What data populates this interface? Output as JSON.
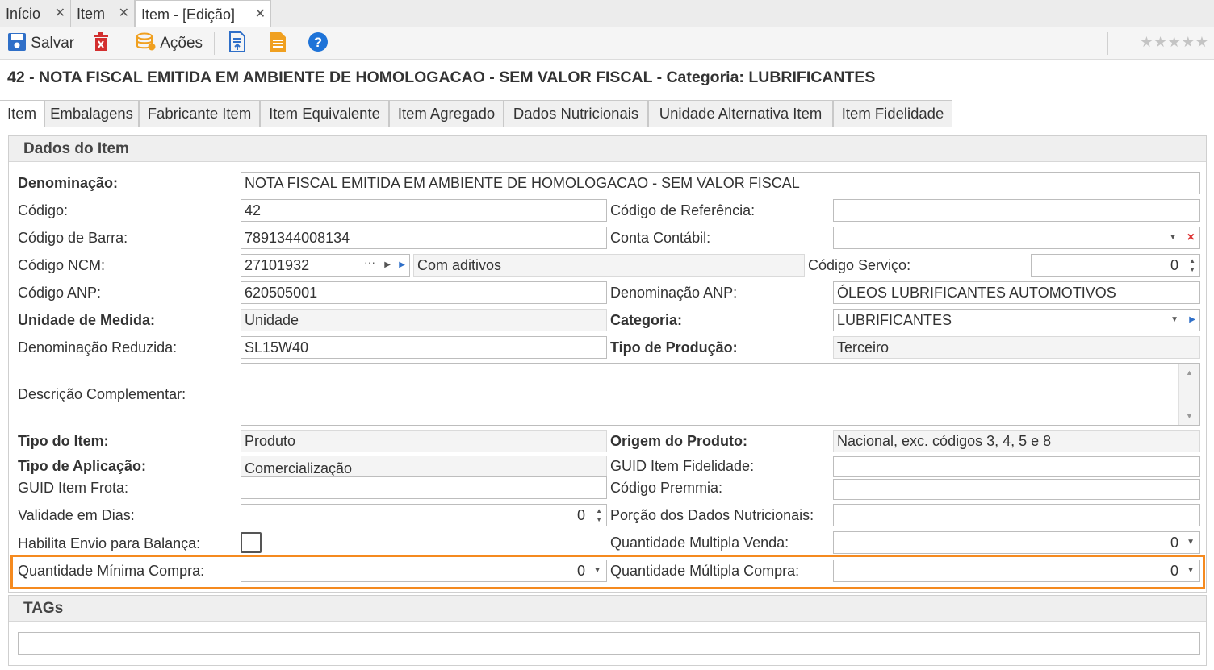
{
  "doc_tabs": [
    {
      "label": "Início",
      "close": "✕"
    },
    {
      "label": "Item",
      "close": "✕"
    },
    {
      "label": "Item - [Edição]",
      "close": "✕"
    }
  ],
  "toolbar": {
    "save_label": "Salvar",
    "actions_label": "Ações",
    "help_glyph": "?",
    "stars": "★★★★★"
  },
  "title": "42 - NOTA FISCAL EMITIDA EM AMBIENTE DE HOMOLOGACAO - SEM VALOR FISCAL - Categoria: LUBRIFICANTES",
  "section_tabs": [
    "Item",
    "Embalagens",
    "Fabricante Item",
    "Item Equivalente",
    "Item Agregado",
    "Dados Nutricionais",
    "Unidade Alternativa Item",
    "Item Fidelidade"
  ],
  "panel_title": "Dados do Item",
  "labels": {
    "denominacao": "Denominação:",
    "codigo": "Código:",
    "codigo_referencia": "Código de Referência:",
    "codigo_barra": "Código de Barra:",
    "conta_contabil": "Conta Contábil:",
    "codigo_ncm": "Código NCM:",
    "codigo_servico": "Código Serviço:",
    "codigo_anp": "Código ANP:",
    "denominacao_anp": "Denominação ANP:",
    "unidade_medida": "Unidade de Medida:",
    "categoria": "Categoria:",
    "denominacao_reduzida": "Denominação Reduzida:",
    "tipo_producao": "Tipo de Produção:",
    "descricao_complementar": "Descrição Complementar:",
    "tipo_item": "Tipo do Item:",
    "origem_produto": "Origem do Produto:",
    "tipo_aplicacao": "Tipo de Aplicação:",
    "guid_item_fidelidade": "GUID Item Fidelidade:",
    "guid_item_frota": "GUID Item Frota:",
    "codigo_premmia": "Código Premmia:",
    "validade_dias": "Validade em Dias:",
    "porcao_dados_nutricionais": "Porção dos Dados Nutricionais:",
    "habilita_envio_balanca": "Habilita Envio para Balança:",
    "quantidade_multipla_venda": "Quantidade Multipla Venda:",
    "quantidade_minima_compra": "Quantidade Mínima Compra:",
    "quantidade_multipla_compra": "Quantidade Múltipla Compra:"
  },
  "values": {
    "denominacao": "NOTA FISCAL EMITIDA EM AMBIENTE DE HOMOLOGACAO - SEM VALOR FISCAL",
    "codigo": "42",
    "codigo_referencia": "",
    "codigo_barra": "7891344008134",
    "conta_contabil": "",
    "codigo_ncm": "27101932",
    "ncm_descricao": "Com aditivos",
    "codigo_servico": "0",
    "codigo_anp": "620505001",
    "denominacao_anp": "ÓLEOS LUBRIFICANTES AUTOMOTIVOS",
    "unidade_medida": "Unidade",
    "categoria": "LUBRIFICANTES",
    "denominacao_reduzida": "SL15W40",
    "tipo_producao": "Terceiro",
    "descricao_complementar": "",
    "tipo_item": "Produto",
    "origem_produto": "Nacional, exc. códigos 3, 4, 5 e 8",
    "tipo_aplicacao": "Comercialização",
    "guid_item_fidelidade": "",
    "guid_item_frota": "",
    "codigo_premmia": "",
    "validade_dias": "0",
    "porcao_dados_nutricionais": "",
    "habilita_envio_balanca": false,
    "quantidade_multipla_venda": "0",
    "quantidade_minima_compra": "0",
    "quantidade_multipla_compra": "0"
  },
  "tags_panel_title": "TAGs",
  "colors": {
    "highlight": "#f58a1f",
    "accent_blue": "#2f6fc8",
    "delete_red": "#d32f2f",
    "doc_orange": "#f0a020"
  },
  "icons": {
    "save": "save-icon",
    "delete": "delete-icon",
    "actions": "database-actions-icon",
    "export": "export-document-icon",
    "report": "report-document-icon",
    "help": "help-icon"
  }
}
